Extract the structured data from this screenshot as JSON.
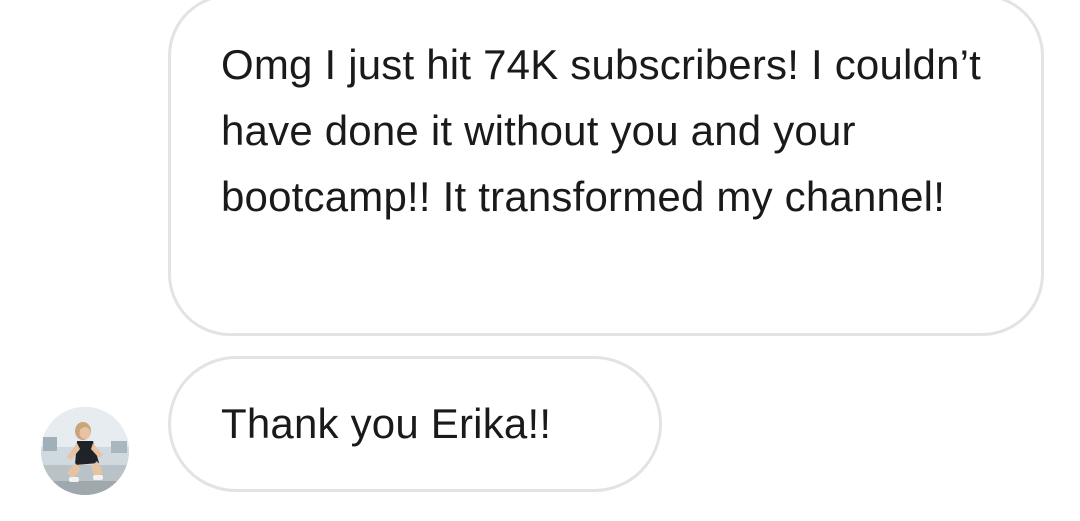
{
  "conversation": {
    "messages": [
      {
        "text": "Omg I just hit 74K subscribers! I couldn’t have done it without you and your bootcamp!! It transformed my channel!"
      },
      {
        "text": "Thank you Erika!!"
      }
    ],
    "sender_avatar_icon": "user-avatar-photo"
  },
  "colors": {
    "background": "#ffffff",
    "bubble_border": "#e3e3e3",
    "text": "#1a1a1a"
  }
}
